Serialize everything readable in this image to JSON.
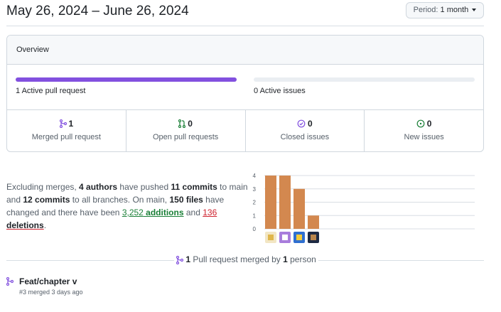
{
  "header": {
    "date_range": "May 26, 2024 – June 26, 2024",
    "period_label": "Period:",
    "period_value": "1 month"
  },
  "overview": {
    "title": "Overview",
    "pull_requests": {
      "label": "1 Active pull request",
      "fill_fraction": 1.0,
      "color": "#8250df"
    },
    "issues": {
      "label": "0 Active issues",
      "fill_fraction": 0.0
    },
    "stats": [
      {
        "value": "1",
        "label": "Merged pull request",
        "icon": "git-merge-icon",
        "color": "#8250df"
      },
      {
        "value": "0",
        "label": "Open pull requests",
        "icon": "git-pull-request-icon",
        "color": "#1a7f37"
      },
      {
        "value": "0",
        "label": "Closed issues",
        "icon": "issue-closed-icon",
        "color": "#8250df"
      },
      {
        "value": "0",
        "label": "New issues",
        "icon": "issue-opened-icon",
        "color": "#1a7f37"
      }
    ]
  },
  "summary": {
    "t1": "Excluding merges, ",
    "authors": "4 authors",
    "t2": " have pushed ",
    "commits_main": "11 commits",
    "t3": " to main and ",
    "commits_all": "12 commits",
    "t4": " to all branches. On main, ",
    "files": "150 files",
    "t5": " have changed and there have been ",
    "additions_num": "3,252",
    "additions_word": " additions",
    "t6": " and ",
    "deletions_num": "136",
    "deletions_word": " deletions",
    "t7": "."
  },
  "chart_data": {
    "type": "bar",
    "categories": [
      "author-1",
      "author-2",
      "author-3",
      "author-4"
    ],
    "values": [
      4,
      4,
      3,
      1
    ],
    "ylim": [
      0,
      4
    ],
    "yticks": [
      "0",
      "1",
      "2",
      "3",
      "4"
    ],
    "bar_color": "#d3884f",
    "grid": true
  },
  "merged": {
    "count": "1",
    "text_mid": " Pull request merged by ",
    "person_count": "1",
    "text_end": " person"
  },
  "pull_requests": [
    {
      "title": "Feat/chapter v",
      "meta": "#3 merged 3 days ago"
    }
  ]
}
